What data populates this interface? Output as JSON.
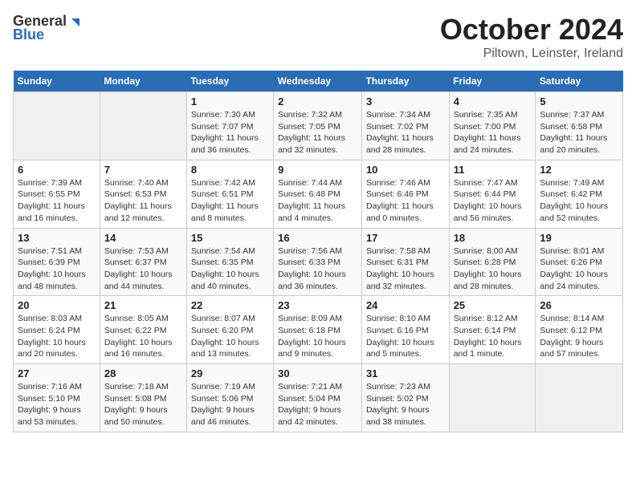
{
  "header": {
    "logo_general": "General",
    "logo_blue": "Blue",
    "title": "October 2024",
    "subtitle": "Piltown, Leinster, Ireland"
  },
  "days_of_week": [
    "Sunday",
    "Monday",
    "Tuesday",
    "Wednesday",
    "Thursday",
    "Friday",
    "Saturday"
  ],
  "weeks": [
    [
      {
        "day": "",
        "sunrise": "",
        "sunset": "",
        "daylight": ""
      },
      {
        "day": "",
        "sunrise": "",
        "sunset": "",
        "daylight": ""
      },
      {
        "day": "1",
        "sunrise": "Sunrise: 7:30 AM",
        "sunset": "Sunset: 7:07 PM",
        "daylight": "Daylight: 11 hours and 36 minutes."
      },
      {
        "day": "2",
        "sunrise": "Sunrise: 7:32 AM",
        "sunset": "Sunset: 7:05 PM",
        "daylight": "Daylight: 11 hours and 32 minutes."
      },
      {
        "day": "3",
        "sunrise": "Sunrise: 7:34 AM",
        "sunset": "Sunset: 7:02 PM",
        "daylight": "Daylight: 11 hours and 28 minutes."
      },
      {
        "day": "4",
        "sunrise": "Sunrise: 7:35 AM",
        "sunset": "Sunset: 7:00 PM",
        "daylight": "Daylight: 11 hours and 24 minutes."
      },
      {
        "day": "5",
        "sunrise": "Sunrise: 7:37 AM",
        "sunset": "Sunset: 6:58 PM",
        "daylight": "Daylight: 11 hours and 20 minutes."
      }
    ],
    [
      {
        "day": "6",
        "sunrise": "Sunrise: 7:39 AM",
        "sunset": "Sunset: 6:55 PM",
        "daylight": "Daylight: 11 hours and 16 minutes."
      },
      {
        "day": "7",
        "sunrise": "Sunrise: 7:40 AM",
        "sunset": "Sunset: 6:53 PM",
        "daylight": "Daylight: 11 hours and 12 minutes."
      },
      {
        "day": "8",
        "sunrise": "Sunrise: 7:42 AM",
        "sunset": "Sunset: 6:51 PM",
        "daylight": "Daylight: 11 hours and 8 minutes."
      },
      {
        "day": "9",
        "sunrise": "Sunrise: 7:44 AM",
        "sunset": "Sunset: 6:48 PM",
        "daylight": "Daylight: 11 hours and 4 minutes."
      },
      {
        "day": "10",
        "sunrise": "Sunrise: 7:46 AM",
        "sunset": "Sunset: 6:46 PM",
        "daylight": "Daylight: 11 hours and 0 minutes."
      },
      {
        "day": "11",
        "sunrise": "Sunrise: 7:47 AM",
        "sunset": "Sunset: 6:44 PM",
        "daylight": "Daylight: 10 hours and 56 minutes."
      },
      {
        "day": "12",
        "sunrise": "Sunrise: 7:49 AM",
        "sunset": "Sunset: 6:42 PM",
        "daylight": "Daylight: 10 hours and 52 minutes."
      }
    ],
    [
      {
        "day": "13",
        "sunrise": "Sunrise: 7:51 AM",
        "sunset": "Sunset: 6:39 PM",
        "daylight": "Daylight: 10 hours and 48 minutes."
      },
      {
        "day": "14",
        "sunrise": "Sunrise: 7:53 AM",
        "sunset": "Sunset: 6:37 PM",
        "daylight": "Daylight: 10 hours and 44 minutes."
      },
      {
        "day": "15",
        "sunrise": "Sunrise: 7:54 AM",
        "sunset": "Sunset: 6:35 PM",
        "daylight": "Daylight: 10 hours and 40 minutes."
      },
      {
        "day": "16",
        "sunrise": "Sunrise: 7:56 AM",
        "sunset": "Sunset: 6:33 PM",
        "daylight": "Daylight: 10 hours and 36 minutes."
      },
      {
        "day": "17",
        "sunrise": "Sunrise: 7:58 AM",
        "sunset": "Sunset: 6:31 PM",
        "daylight": "Daylight: 10 hours and 32 minutes."
      },
      {
        "day": "18",
        "sunrise": "Sunrise: 8:00 AM",
        "sunset": "Sunset: 6:28 PM",
        "daylight": "Daylight: 10 hours and 28 minutes."
      },
      {
        "day": "19",
        "sunrise": "Sunrise: 8:01 AM",
        "sunset": "Sunset: 6:26 PM",
        "daylight": "Daylight: 10 hours and 24 minutes."
      }
    ],
    [
      {
        "day": "20",
        "sunrise": "Sunrise: 8:03 AM",
        "sunset": "Sunset: 6:24 PM",
        "daylight": "Daylight: 10 hours and 20 minutes."
      },
      {
        "day": "21",
        "sunrise": "Sunrise: 8:05 AM",
        "sunset": "Sunset: 6:22 PM",
        "daylight": "Daylight: 10 hours and 16 minutes."
      },
      {
        "day": "22",
        "sunrise": "Sunrise: 8:07 AM",
        "sunset": "Sunset: 6:20 PM",
        "daylight": "Daylight: 10 hours and 13 minutes."
      },
      {
        "day": "23",
        "sunrise": "Sunrise: 8:09 AM",
        "sunset": "Sunset: 6:18 PM",
        "daylight": "Daylight: 10 hours and 9 minutes."
      },
      {
        "day": "24",
        "sunrise": "Sunrise: 8:10 AM",
        "sunset": "Sunset: 6:16 PM",
        "daylight": "Daylight: 10 hours and 5 minutes."
      },
      {
        "day": "25",
        "sunrise": "Sunrise: 8:12 AM",
        "sunset": "Sunset: 6:14 PM",
        "daylight": "Daylight: 10 hours and 1 minute."
      },
      {
        "day": "26",
        "sunrise": "Sunrise: 8:14 AM",
        "sunset": "Sunset: 6:12 PM",
        "daylight": "Daylight: 9 hours and 57 minutes."
      }
    ],
    [
      {
        "day": "27",
        "sunrise": "Sunrise: 7:16 AM",
        "sunset": "Sunset: 5:10 PM",
        "daylight": "Daylight: 9 hours and 53 minutes."
      },
      {
        "day": "28",
        "sunrise": "Sunrise: 7:18 AM",
        "sunset": "Sunset: 5:08 PM",
        "daylight": "Daylight: 9 hours and 50 minutes."
      },
      {
        "day": "29",
        "sunrise": "Sunrise: 7:19 AM",
        "sunset": "Sunset: 5:06 PM",
        "daylight": "Daylight: 9 hours and 46 minutes."
      },
      {
        "day": "30",
        "sunrise": "Sunrise: 7:21 AM",
        "sunset": "Sunset: 5:04 PM",
        "daylight": "Daylight: 9 hours and 42 minutes."
      },
      {
        "day": "31",
        "sunrise": "Sunrise: 7:23 AM",
        "sunset": "Sunset: 5:02 PM",
        "daylight": "Daylight: 9 hours and 38 minutes."
      },
      {
        "day": "",
        "sunrise": "",
        "sunset": "",
        "daylight": ""
      },
      {
        "day": "",
        "sunrise": "",
        "sunset": "",
        "daylight": ""
      }
    ]
  ]
}
